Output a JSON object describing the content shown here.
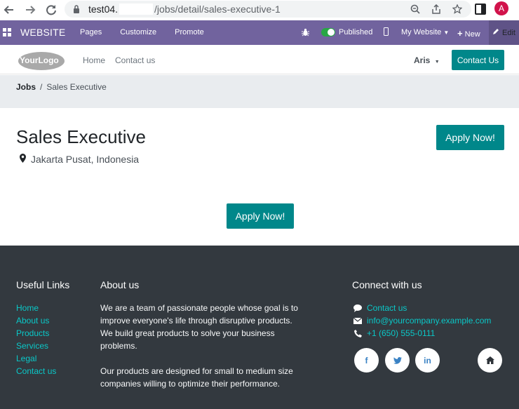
{
  "browser": {
    "url_host": "test04.",
    "url_path": "/jobs/detail/sales-executive-1",
    "avatar_letter": "A"
  },
  "odoo_bar": {
    "app_name": "WEBSITE",
    "menu": [
      "Pages",
      "Customize",
      "Promote"
    ],
    "published_label": "Published",
    "my_website_label": "My Website",
    "new_label": "New",
    "edit_label": "Edit"
  },
  "site_header": {
    "logo_text": "YourLogo",
    "nav": [
      "Home",
      "Contact us"
    ],
    "user": "Aris",
    "contact_button": "Contact Us"
  },
  "breadcrumb": {
    "root": "Jobs",
    "separator": "/",
    "current": "Sales Executive"
  },
  "job": {
    "title": "Sales Executive",
    "location": "Jakarta Pusat, Indonesia",
    "apply_label": "Apply Now!"
  },
  "footer": {
    "useful_links_heading": "Useful Links",
    "links": [
      "Home",
      "About us",
      "Products",
      "Services",
      "Legal",
      "Contact us"
    ],
    "about_heading": "About us",
    "about_p1": "We are a team of passionate people whose goal is to improve everyone's life through disruptive products. We build great products to solve your business problems.",
    "about_p2": "Our products are designed for small to medium size companies willing to optimize their performance.",
    "connect_heading": "Connect with us",
    "contact_link": "Contact us",
    "email": "info@yourcompany.example.com",
    "phone": "+1 (650) 555-0111",
    "social": [
      "facebook-icon",
      "twitter-icon",
      "linkedin-icon",
      "home-icon"
    ]
  },
  "colors": {
    "odoo_purple": "#71639e",
    "teal": "#00878a",
    "footer_bg": "#33393f",
    "link_cyan": "#0ac8c8"
  }
}
